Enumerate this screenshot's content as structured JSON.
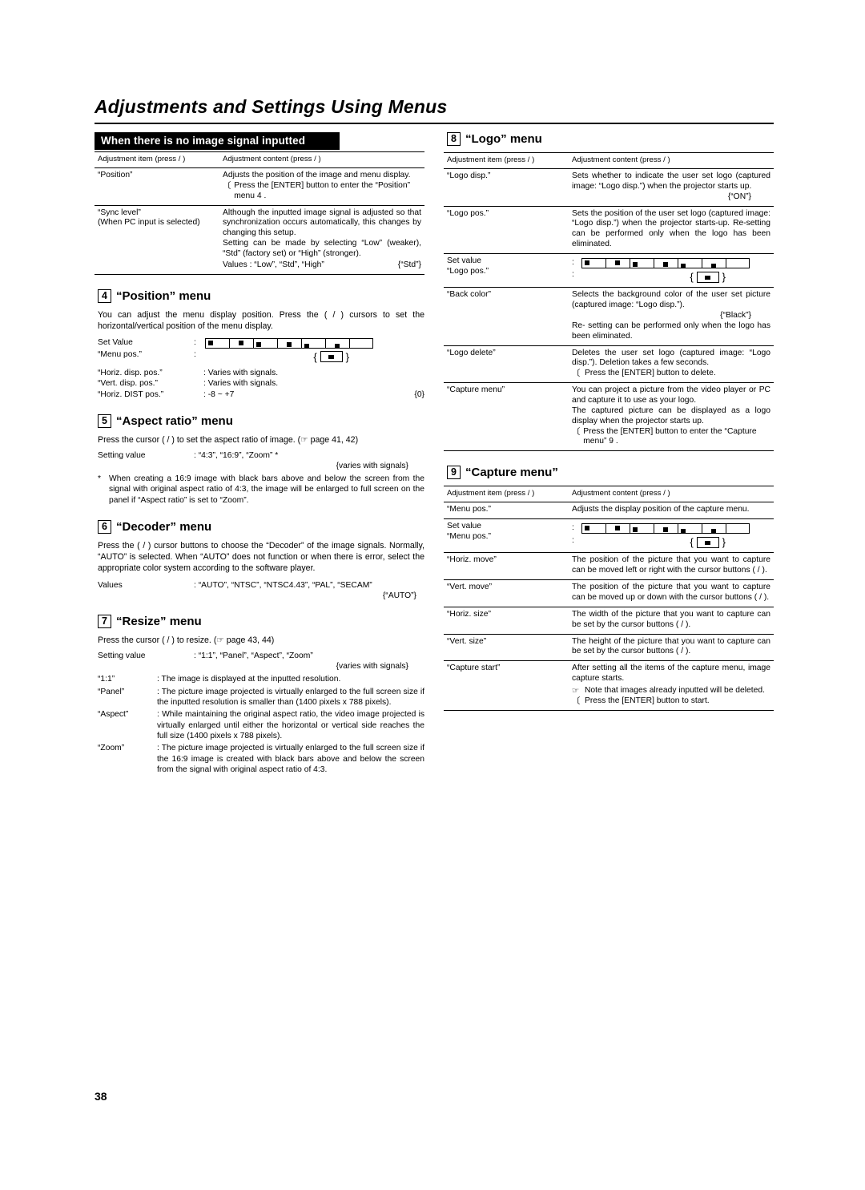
{
  "page": {
    "title": "Adjustments and Settings Using Menus",
    "number": "38"
  },
  "left": {
    "banner": "When there is no image signal inputted",
    "table1": {
      "headers": [
        "Adjustment item (press  /  )",
        "Adjustment content (press  /  )"
      ],
      "rows": [
        {
          "item": "“Position”",
          "content": "Adjusts the position of the image and menu display.",
          "note": "Press the [ENTER] button to enter the “Position” menu 4 ."
        },
        {
          "item": "“Sync level”\n(When PC input is selected)",
          "content": "Although the inputted image signal is adjusted so that synchronization occurs automatically, this changes by changing this setup.\nSetting can be made by selecting “Low” (weaker), “Std” (factory set) or “High” (stronger).",
          "values": "Values : “Low”, “Std”, “High”",
          "default": "{“Std”}"
        }
      ]
    },
    "position_menu": {
      "num": "4",
      "title": "“Position” menu",
      "body": "You can adjust the menu display position. Press the (  /  ) cursors to set the horizontal/vertical position of the menu display.",
      "setvalue_label": "Set Value",
      "setvalue_label2": "“Menu pos.”",
      "rows": [
        {
          "k": "“Horiz. disp. pos.”",
          "v": ": Varies with signals."
        },
        {
          "k": "“Vert. disp. pos.”",
          "v": ": Varies with signals."
        },
        {
          "k": "“Horiz. DIST pos.”",
          "v": ": -8 ~ +7",
          "d": "{0}"
        }
      ]
    },
    "aspect_menu": {
      "num": "5",
      "title": "“Aspect ratio” menu",
      "body": "Press the cursor (  /  ) to set the aspect ratio of image. (☞ page 41, 42)",
      "setting_label": "Setting value",
      "setting_value": ": “4:3”, “16:9”, “Zoom” *",
      "setting_default": "{varies with signals}",
      "footnote_mark": "*",
      "footnote": "When creating a 16:9 image with black bars above and below the screen from the signal with original aspect ratio of 4:3, the image will be enlarged to full screen on the panel if “Aspect ratio” is set to “Zoom”."
    },
    "decoder_menu": {
      "num": "6",
      "title": "“Decoder” menu",
      "body": "Press the (  /  ) cursor buttons to choose the “Decoder” of the image signals. Normally, “AUTO” is selected. When “AUTO” does not function or when there is error, select the appropriate color system according to the software player.",
      "values_label": "Values",
      "values_value": ": “AUTO”, “NTSC”, “NTSC4.43”, “PAL”, “SECAM”",
      "values_default": "{“AUTO”}"
    },
    "resize_menu": {
      "num": "7",
      "title": "“Resize” menu",
      "body": "Press the cursor (  /  ) to resize. (☞ page 43, 44)",
      "setting_label": "Setting value",
      "setting_value": ": “1:1”, “Panel”, “Aspect”, “Zoom”",
      "setting_default": "{varies with signals}",
      "rows": [
        {
          "k": "“1:1”",
          "v": ": The image is displayed at the inputted resolution."
        },
        {
          "k": "“Panel”",
          "v": ": The picture image projected is virtually enlarged to the full screen size if the inputted resolution is smaller than (1400 pixels x 788 pixels)."
        },
        {
          "k": "“Aspect”",
          "v": ": While maintaining the original aspect ratio, the video image projected is virtually enlarged until either the horizontal or vertical side reaches the full size (1400 pixels x 788 pixels)."
        },
        {
          "k": "“Zoom”",
          "v": ": The picture image projected is virtually enlarged to the full screen size if the 16:9 image is created with black bars above and below the screen from the signal with original aspect ratio of 4:3."
        }
      ]
    }
  },
  "right": {
    "logo_menu": {
      "num": "8",
      "title": "“Logo” menu",
      "headers": [
        "Adjustment item (press  /  )",
        "Adjustment content (press  /  )"
      ],
      "rows": [
        {
          "item": "“Logo disp.”",
          "content": "Sets whether to indicate the user set logo (captured image: “Logo disp.”) when the projector starts up.",
          "default": "{“ON”}"
        },
        {
          "item": "“Logo pos.”",
          "content": "Sets the position of the user set logo (captured image: “Logo disp.”) when the projector starts-up. Re-setting can be performed only when the logo has been eliminated."
        },
        {
          "item": "Set value\n“Logo pos.”",
          "content": "slider-graphic"
        },
        {
          "item": "“Back color”",
          "content": "Selects the background color of the user set picture (captured image: “Logo disp.”).",
          "default": "{“Black”}",
          "extra": "Re- setting can be performed only when the logo has been eliminated."
        },
        {
          "item": "“Logo delete”",
          "content": "Deletes the user set logo (captured image: “Logo disp.”). Deletion takes a few seconds.",
          "note": "Press the [ENTER] button to delete."
        },
        {
          "item": "“Capture menu”",
          "content": "You can project a picture from the video player or PC and capture it to use as your logo.\nThe captured picture can be displayed as a logo display when the projector starts up.",
          "note": "Press the [ENTER] button to enter the “Capture menu” 9 ."
        }
      ]
    },
    "capture_menu": {
      "num": "9",
      "title": "“Capture menu”",
      "headers": [
        "Adjustment item (press  /  )",
        "Adjustment content (press  /  )"
      ],
      "rows": [
        {
          "item": "“Menu pos.”",
          "content": "Adjusts the display position of the capture menu."
        },
        {
          "item": "Set value\n“Menu pos.”",
          "content": "slider-graphic"
        },
        {
          "item": "“Horiz. move”",
          "content": "The position of the picture that you want to capture can be moved left or right with the cursor buttons (  /  )."
        },
        {
          "item": "“Vert. move”",
          "content": "The position of the picture that you want to capture can be moved up or down with the cursor buttons (  /  )."
        },
        {
          "item": "“Horiz. size”",
          "content": "The width of the picture that you want to capture can be set by the cursor buttons (  /  )."
        },
        {
          "item": "“Vert. size”",
          "content": "The height of the picture that you want to capture can be set by the cursor buttons (  /  )."
        },
        {
          "item": "“Capture start”",
          "content": "After setting all the items of the capture menu, image capture starts.",
          "memo": "Note that images already inputted will be deleted.",
          "note": "Press the [ENTER] button to start."
        }
      ]
    }
  }
}
